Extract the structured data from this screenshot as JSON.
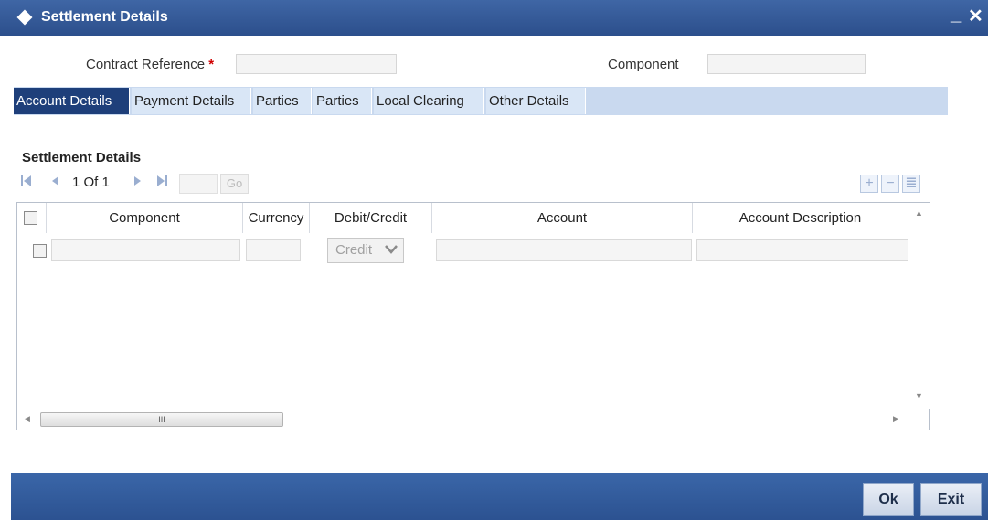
{
  "window": {
    "title": "Settlement Details",
    "minimize_glyph": "_",
    "close_glyph": "✕"
  },
  "header": {
    "contract_reference_label": "Contract Reference",
    "required_marker": "*",
    "contract_reference_value": "",
    "component_label": "Component",
    "component_value": ""
  },
  "tabs": [
    {
      "label": "Account Details",
      "active": true
    },
    {
      "label": "Payment Details",
      "active": false
    },
    {
      "label": "Parties",
      "active": false
    },
    {
      "label": "Parties",
      "active": false
    },
    {
      "label": "Local Clearing",
      "active": false
    },
    {
      "label": "Other Details",
      "active": false
    }
  ],
  "section": {
    "title": "Settlement Details"
  },
  "pager": {
    "text": "1 Of 1",
    "go_label": "Go",
    "page_value": ""
  },
  "toolbar": {
    "add_glyph": "+",
    "delete_glyph": "−",
    "view_glyph": "≣"
  },
  "grid": {
    "columns": [
      "Component",
      "Currency",
      "Debit/Credit",
      "Account",
      "Account Description"
    ],
    "rows": [
      {
        "component": "",
        "currency": "",
        "debit_credit": "Credit",
        "account": "",
        "account_description": ""
      }
    ],
    "hscroll_thumb_glyph": "III"
  },
  "footer": {
    "ok_label": "Ok",
    "exit_label": "Exit"
  },
  "icons": {
    "title": "diamond-icon",
    "first": "first-page-icon",
    "prev": "previous-page-icon",
    "next": "next-page-icon",
    "last": "last-page-icon",
    "dropdown": "chevron-down-icon"
  },
  "colors": {
    "titlebar": "#2f5596",
    "active_tab": "#1e3f7a",
    "tab": "#d9e6f6",
    "required": "#d00000"
  }
}
